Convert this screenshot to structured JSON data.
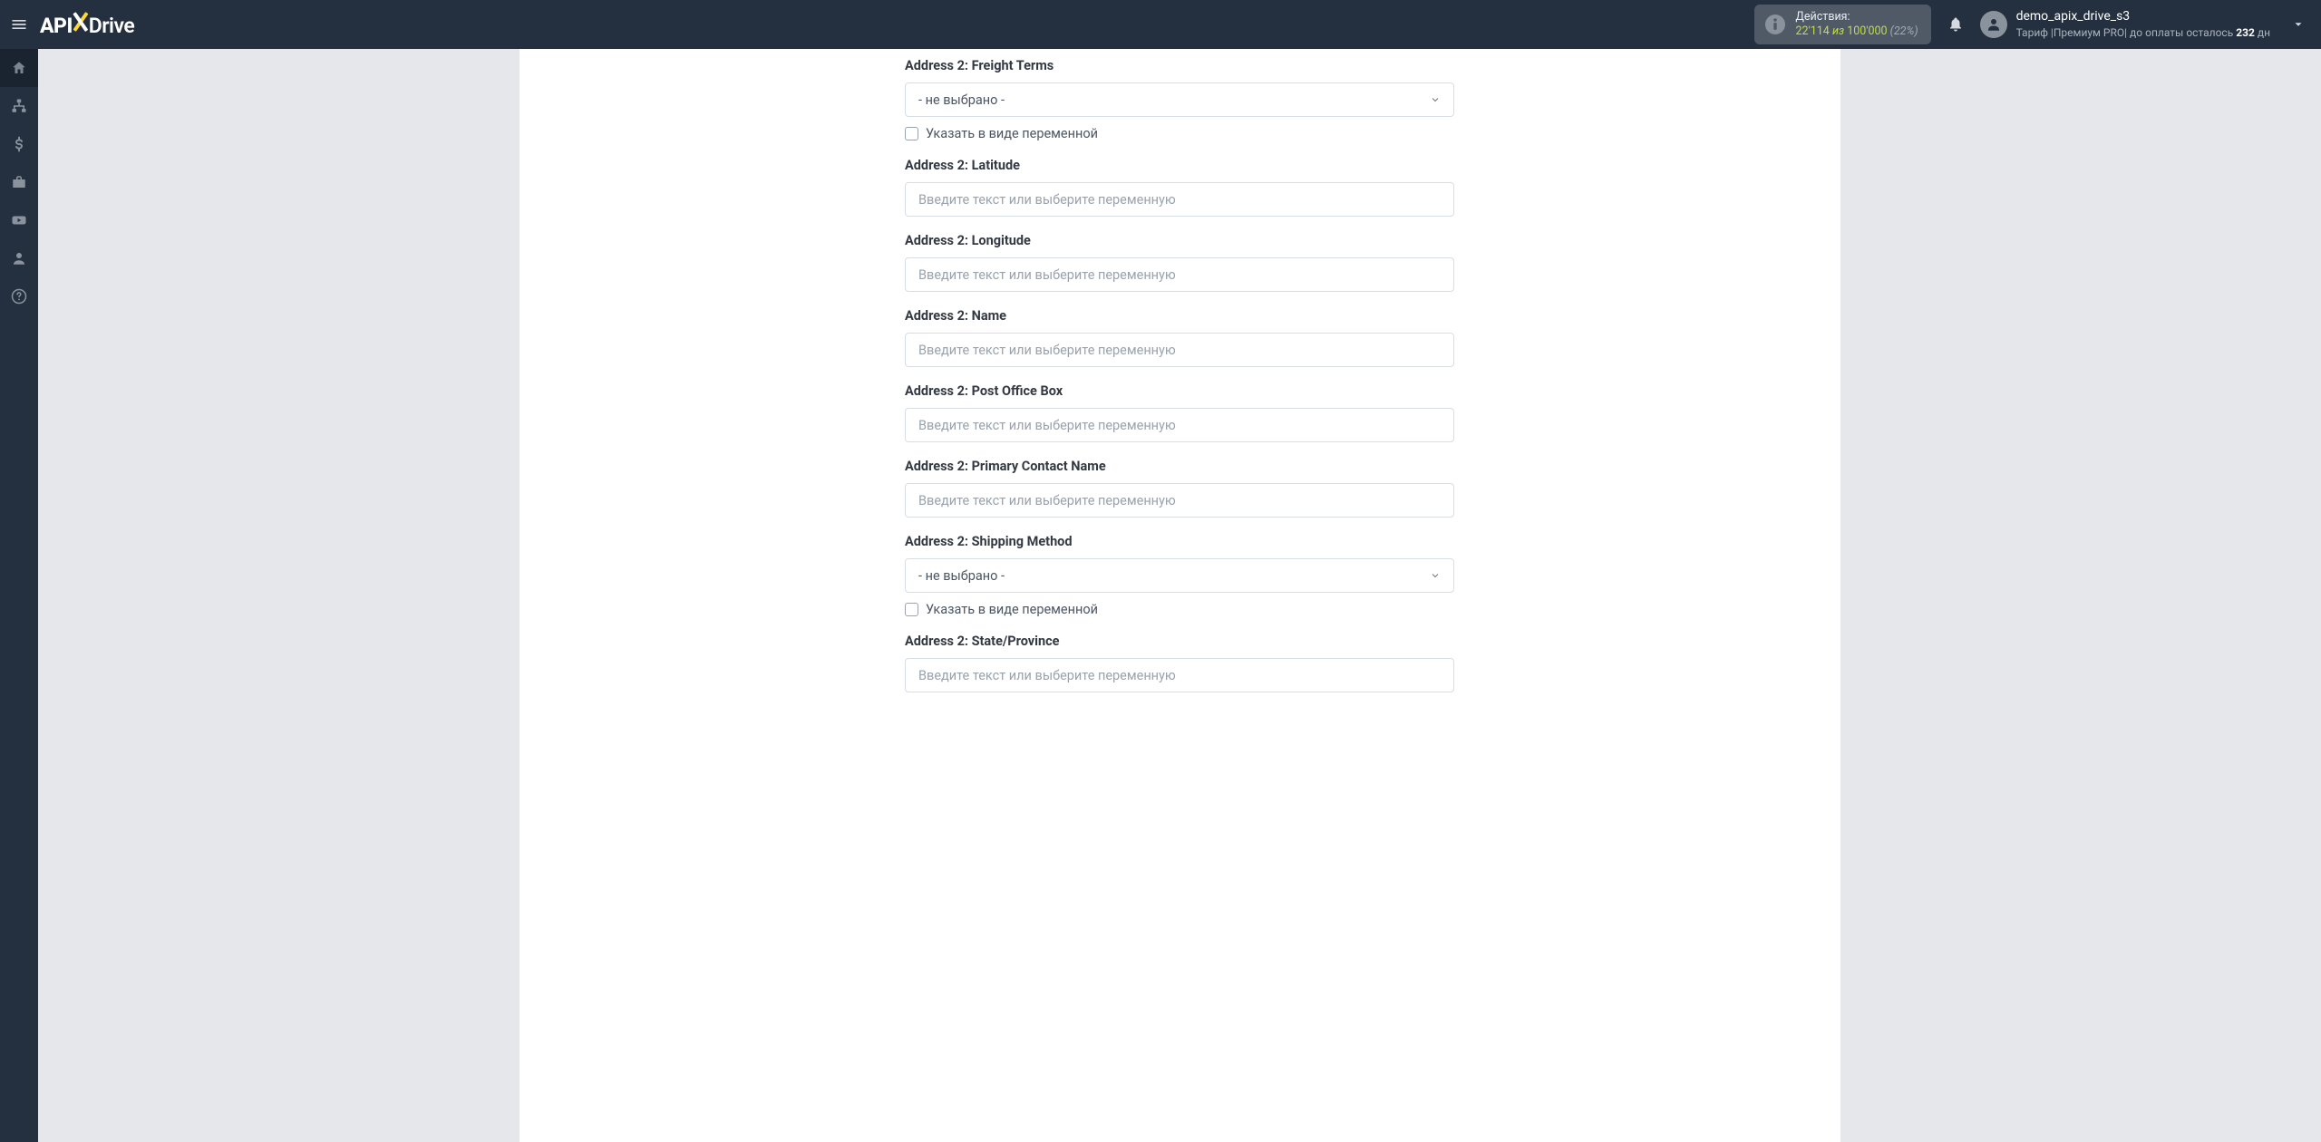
{
  "brand": {
    "part1": "API",
    "part2": "Drive"
  },
  "header": {
    "actions_label": "Действия:",
    "count_used": "22'114",
    "count_from_word": "из",
    "count_total": "100'000",
    "count_pct": "(22%)",
    "user_name": "demo_apix_drive_s3",
    "tariff_prefix": "Тариф |",
    "tariff_name": "Премиум PRO",
    "pay_sep": "| ",
    "pay_text_prefix": "до оплаты осталось ",
    "pay_days": "232",
    "pay_suffix": " дн"
  },
  "common": {
    "placeholder_text": "Введите текст или выберите переменную",
    "not_selected": "- не выбрано -",
    "as_variable": "Указать в виде переменной"
  },
  "fields": {
    "f1_label": "Address 2: Freight Terms",
    "f2_label": "Address 2: Latitude",
    "f3_label": "Address 2: Longitude",
    "f4_label": "Address 2: Name",
    "f5_label": "Address 2: Post Office Box",
    "f6_label": "Address 2: Primary Contact Name",
    "f7_label": "Address 2: Shipping Method",
    "f8_label": "Address 2: State/Province"
  }
}
